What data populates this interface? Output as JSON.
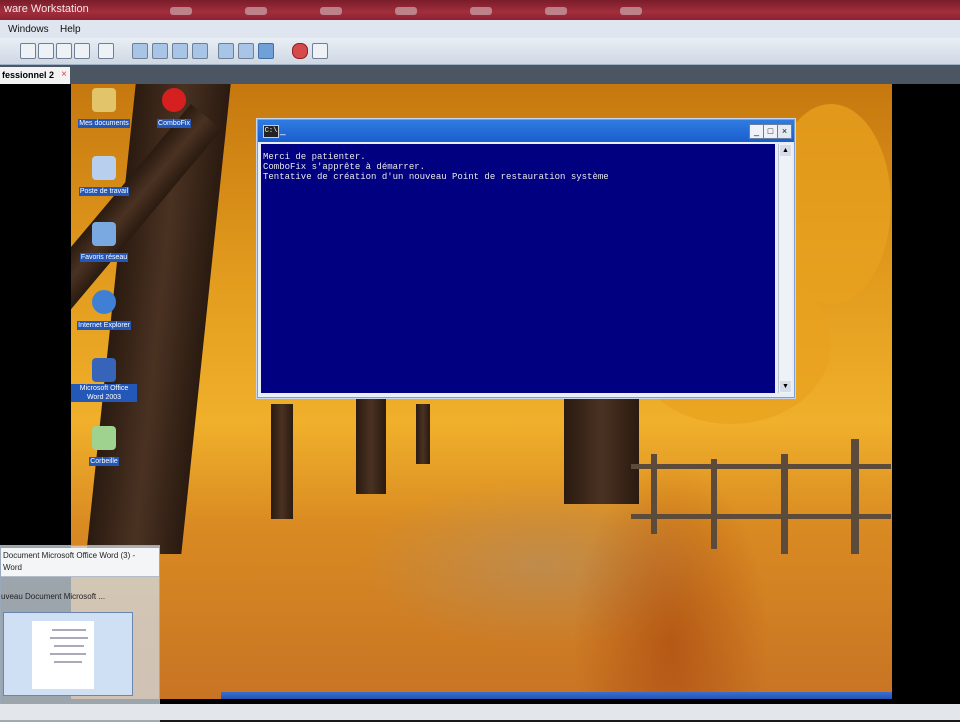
{
  "host_window": {
    "title": "ware Workstation"
  },
  "menu": {
    "items": [
      "Windows",
      "Help"
    ]
  },
  "toolbar": {
    "icons": [
      "snapshot-icon",
      "revert-icon",
      "manage-icon",
      "snapshot-manager-icon",
      "network-icon",
      "view-normal-icon",
      "view-console-icon",
      "view-fullscreen-icon",
      "view-quick-switch-icon",
      "view-unity-icon",
      "view-active-icon",
      "record-icon",
      "replay-icon"
    ]
  },
  "tab": {
    "label": "fessionnel 2",
    "close": "×"
  },
  "desktop_icons": [
    {
      "label": "Mes documents",
      "icon": "my-documents-icon",
      "color": "#e2c46a"
    },
    {
      "label": "ComboFix",
      "icon": "combofix-icon",
      "color": "#d62020"
    },
    {
      "label": "Poste de travail",
      "icon": "my-computer-icon",
      "color": "#b8d0ee"
    },
    {
      "label": "Favoris réseau",
      "icon": "network-places-icon",
      "color": "#79a9e0"
    },
    {
      "label": "Internet Explorer",
      "icon": "internet-explorer-icon",
      "color": "#3f7fd4"
    },
    {
      "label": "Microsoft Office Word 2003",
      "icon": "word-icon",
      "color": "#3564b8"
    },
    {
      "label": "Corbeille",
      "icon": "recycle-bin-icon",
      "color": "#9fd28f"
    }
  ],
  "cmd_window": {
    "title": "_",
    "title_icon": "C:\\",
    "lines": [
      "Merci de patienter.",
      "ComboFix s'apprête à démarrer.",
      "",
      "Tentative de création d'un nouveau Point de restauration système"
    ],
    "buttons": {
      "minimize": "_",
      "maximize": "□",
      "close": "×"
    }
  },
  "thumbnail_popup": {
    "item1_line1": "Document Microsoft Office Word (3) -",
    "item1_line2": "Word",
    "item2": "uveau Document Microsoft ..."
  },
  "colors": {
    "console_bg": "#000080",
    "titlebar_blue": "#1a5ed0"
  }
}
